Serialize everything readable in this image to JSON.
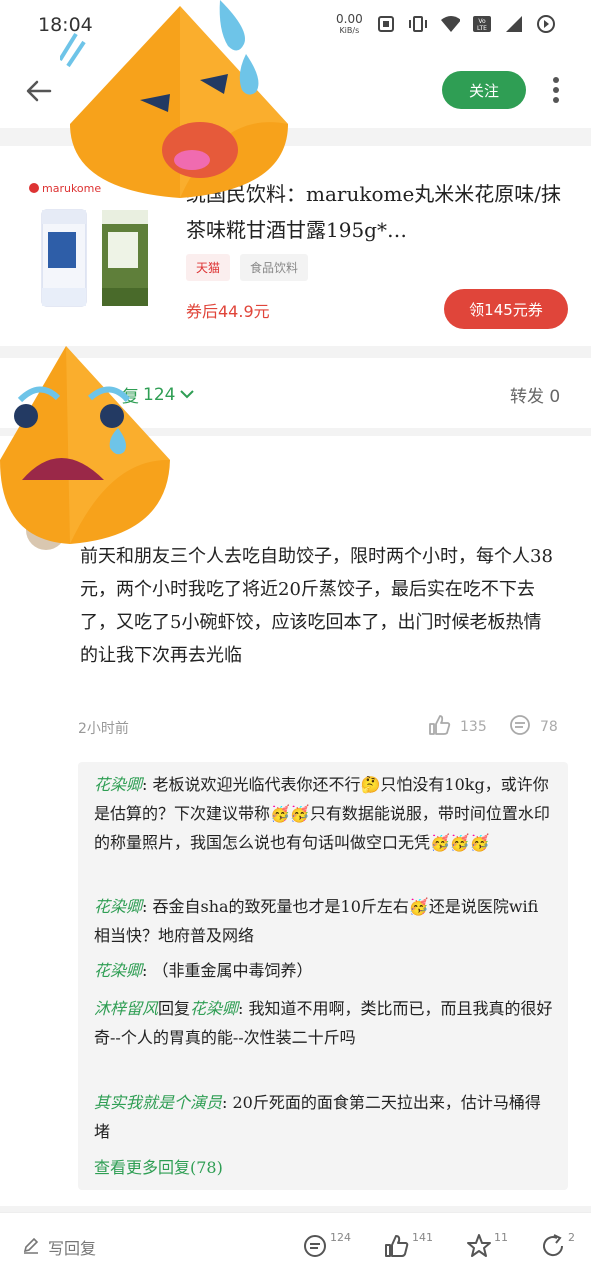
{
  "status_bar": {
    "time": "18:04",
    "net_speed_value": "0.00",
    "net_speed_unit": "KiB/s"
  },
  "top_bar": {
    "follow_label": "关注"
  },
  "product": {
    "title": "统国民饮料：marukome丸米米花原味/抹茶味糀甘酒甘露195g*…",
    "brand_logo_text": "marukome",
    "tags": [
      "天猫",
      "食品饮料"
    ],
    "price_text": "券后44.9元",
    "coupon_button": "领145元券"
  },
  "tabs": {
    "comment_count": "124",
    "comment_label_partial": "复",
    "share_label": "转发 0"
  },
  "comment": {
    "username": "o",
    "text": "前天和朋友三个人去吃自助饺子，限时两个小时，每个人38元，两个小时我吃了将近20斤蒸饺子，最后实在吃不下去了，又吃了5小碗虾饺，应该吃回本了，出门时候老板热情的让我下次再去光临",
    "time": "2小时前",
    "likes": "135",
    "replies_count": "78"
  },
  "replies": [
    {
      "name": "花染卿",
      "text": "老板说欢迎光临代表你还不行🤔只怕没有10kg，或许你是估算的？下次建议带称🥳🥳只有数据能说服，带时间位置水印的称量照片，我国怎么说也有句话叫做空口无凭🥳🥳🥳"
    },
    {
      "name": "花染卿",
      "text": "吞金自sha的致死量也才是10斤左右🥳还是说医院wifi相当快？地府普及网络"
    },
    {
      "name": "花染卿",
      "text": "（非重金属中毒饲养）"
    },
    {
      "name": "沐梓留风",
      "reply_word": "回复",
      "reply_to": "花染卿",
      "text": "我知道不用啊，类比而已，而且我真的很好奇--个人的胃真的能--次性装二十斤吗"
    },
    {
      "name": "其实我就是个演员",
      "text": "20斤死面的面食第二天拉出来，估计马桶得堵"
    }
  ],
  "more_replies": "查看更多回复(78)",
  "bottom_bar": {
    "write_reply": "写回复",
    "comments": "124",
    "likes": "141",
    "favorites": "11",
    "shares": "2"
  },
  "colors": {
    "accent_green": "#2f9e54",
    "price_red": "#e0453a"
  }
}
